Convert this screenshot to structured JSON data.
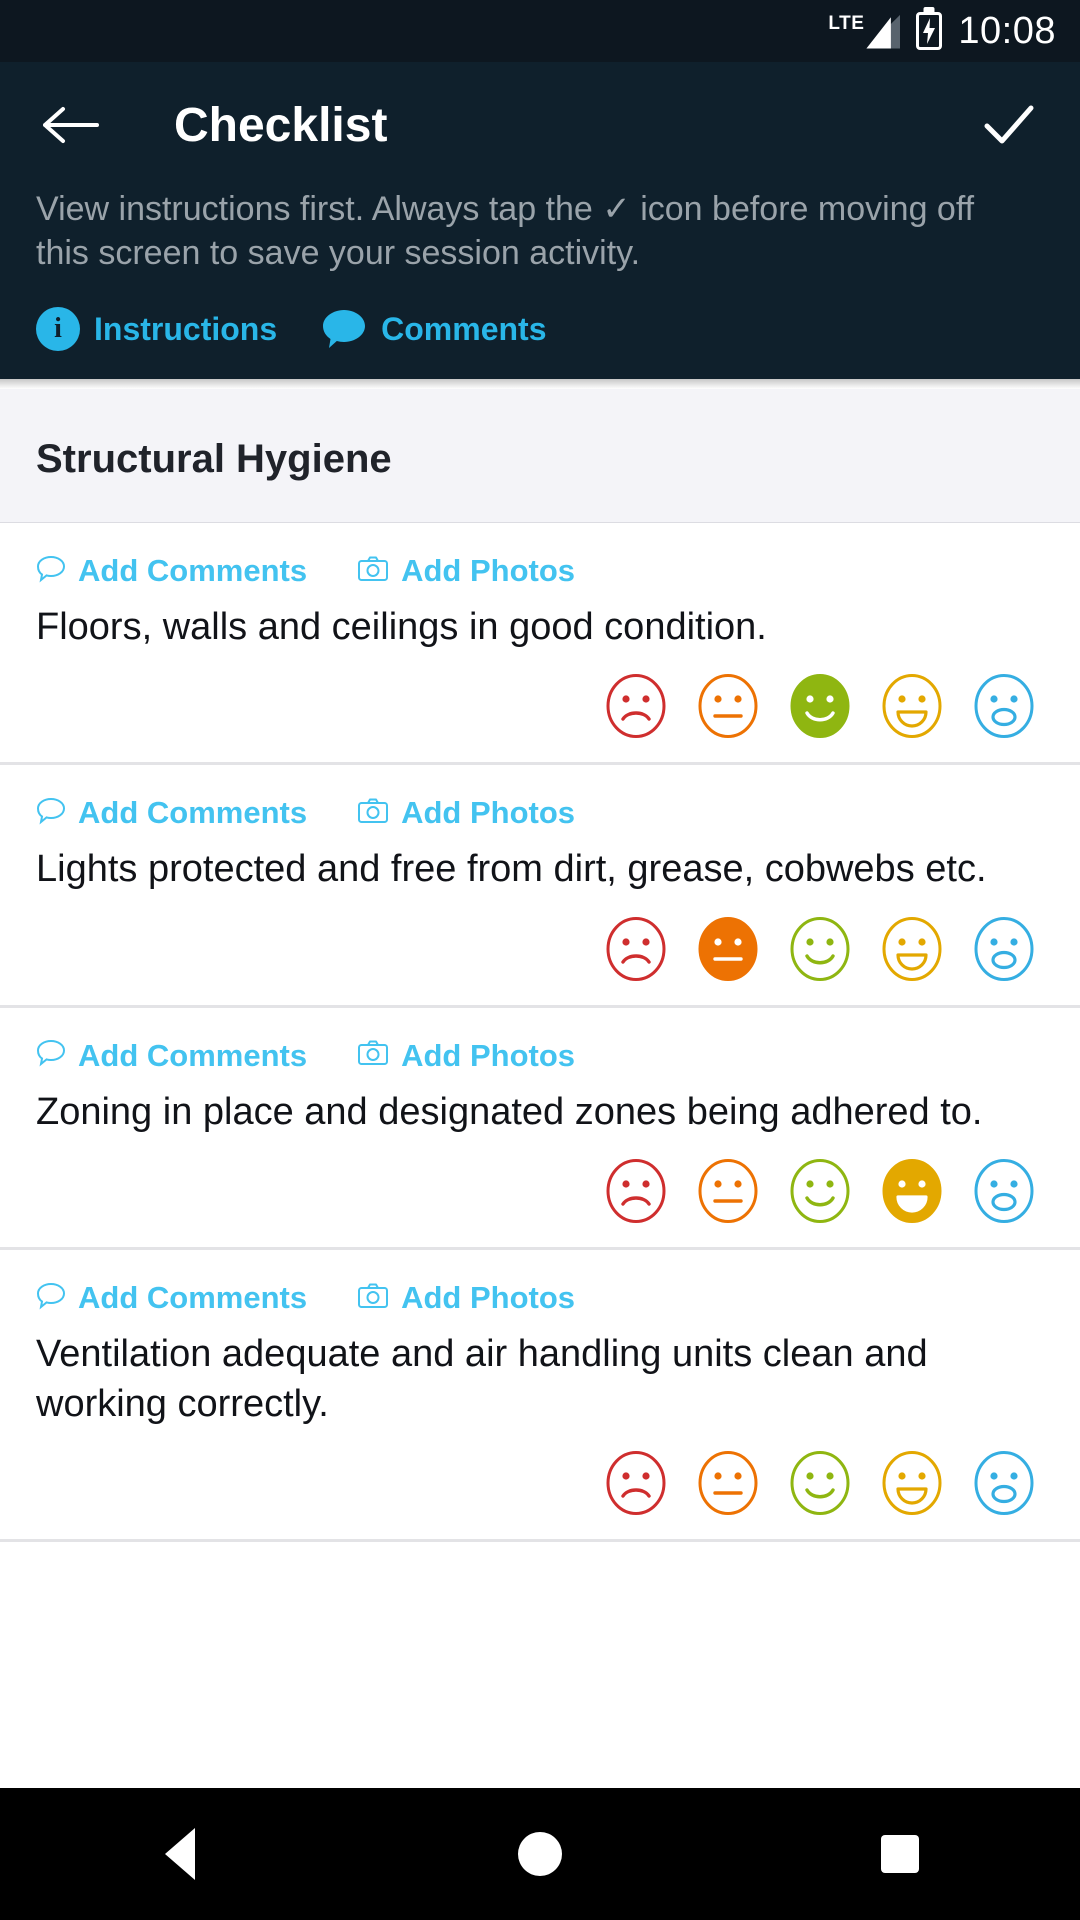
{
  "status_bar": {
    "network_label": "LTE",
    "time": "10:08",
    "signal_icon": "signal-bars-icon",
    "battery_icon": "battery-charging-icon"
  },
  "app_bar": {
    "back_icon": "arrow-left-icon",
    "title": "Checklist",
    "confirm_icon": "check-icon",
    "description": "View instructions first. Always tap the ✓ icon before moving off this screen to save your session activity.",
    "links": [
      {
        "label": "Instructions",
        "icon": "info-icon",
        "glyph": "i"
      },
      {
        "label": "Comments",
        "icon": "comment-bubble-icon"
      }
    ]
  },
  "section": {
    "title": "Structural Hygiene"
  },
  "colors": {
    "accent_link": "#43c3f0",
    "header_link": "#29b6e8",
    "app_bar_bg": "#0f202c",
    "status_bar_bg": "#0d1720",
    "section_bg": "#f4f4f8",
    "face_sad": "#cf2e2e",
    "face_neutral": "#ed7203",
    "face_smile": "#8fb611",
    "face_grin": "#e3a800",
    "face_surprised": "#35aee2"
  },
  "actions": {
    "add_comments_label": "Add Comments",
    "add_comments_icon": "comment-bubble-icon",
    "add_photos_label": "Add Photos",
    "add_photos_icon": "camera-icon"
  },
  "rating_scale": [
    {
      "name": "sad",
      "color": "#cf2e2e"
    },
    {
      "name": "neutral",
      "color": "#ed7203"
    },
    {
      "name": "smile",
      "color": "#8fb611"
    },
    {
      "name": "grin",
      "color": "#e3a800"
    },
    {
      "name": "surprised",
      "color": "#35aee2"
    }
  ],
  "items": [
    {
      "text": "Floors, walls and ceilings in good condition.",
      "selected_index": 2
    },
    {
      "text": "Lights protected and free from dirt, grease, cobwebs etc.",
      "selected_index": 1
    },
    {
      "text": "Zoning in place and designated zones being adhered to.",
      "selected_index": 3
    },
    {
      "text": "Ventilation adequate and air handling units clean and working correctly.",
      "selected_index": -1
    }
  ],
  "nav_bar": {
    "back_icon": "triangle-back-icon",
    "home_icon": "circle-home-icon",
    "recent_icon": "square-recents-icon"
  }
}
